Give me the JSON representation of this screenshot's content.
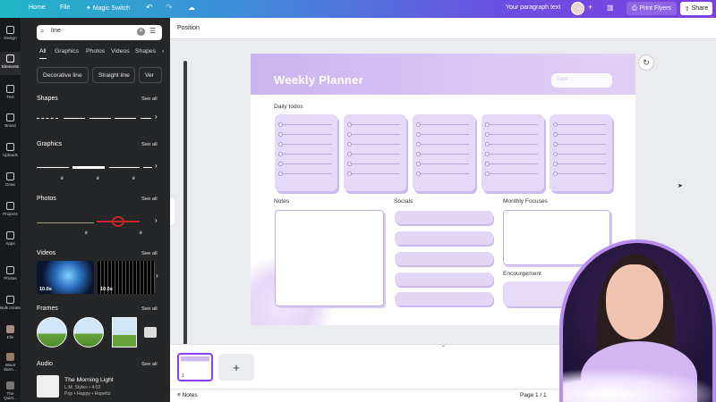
{
  "topbar": {
    "home": "Home",
    "file": "File",
    "magic_switch": "Magic Switch",
    "doc_title": "Your paragraph text",
    "print_label": "Print Flyers",
    "share_label": "Share"
  },
  "rail": [
    {
      "label": "Design"
    },
    {
      "label": "Elements"
    },
    {
      "label": "Text"
    },
    {
      "label": "Brand"
    },
    {
      "label": "Uploads"
    },
    {
      "label": "Draw"
    },
    {
      "label": "Projects"
    },
    {
      "label": "Apps"
    },
    {
      "label": "Photos"
    },
    {
      "label": "Bulk create"
    },
    {
      "label": "Elle"
    },
    {
      "label": "Wave Elem..."
    },
    {
      "label": "The Quiet..."
    }
  ],
  "panel": {
    "search_value": "line",
    "tabs": [
      "All",
      "Graphics",
      "Photos",
      "Videos",
      "Shapes"
    ],
    "chips": [
      "Decorative line",
      "Straight line",
      "Ver"
    ],
    "sections": {
      "shapes": "Shapes",
      "graphics": "Graphics",
      "photos": "Photos",
      "videos": "Videos",
      "frames": "Frames",
      "audio": "Audio"
    },
    "see_all": "See all",
    "video_durations": [
      "10.0s",
      "10.0s"
    ],
    "audio": {
      "title": "The Morning Light",
      "artist": "L.M. Styles • 4:02",
      "tags": "Pop • Happy • Hopeful"
    }
  },
  "toolbar": {
    "position_label": "Position"
  },
  "planner": {
    "title": "Weekly Planner",
    "date_placeholder": "Date",
    "daily_todos": "Daily todos",
    "notes": "Notes",
    "socials": "Socials",
    "monthly_focuses": "Monthly Focuses",
    "encouragement": "Encourgement"
  },
  "bottom": {
    "page_num": "1",
    "add_page": "+",
    "notes_label": "Notes",
    "page_indicator": "Page 1 / 1"
  },
  "colors": {
    "brand_gradient_start": "#22b5c8",
    "brand_gradient_end": "#7b3fe0",
    "planner_purple": "#e4d9f8",
    "accent": "#8b3dff"
  }
}
